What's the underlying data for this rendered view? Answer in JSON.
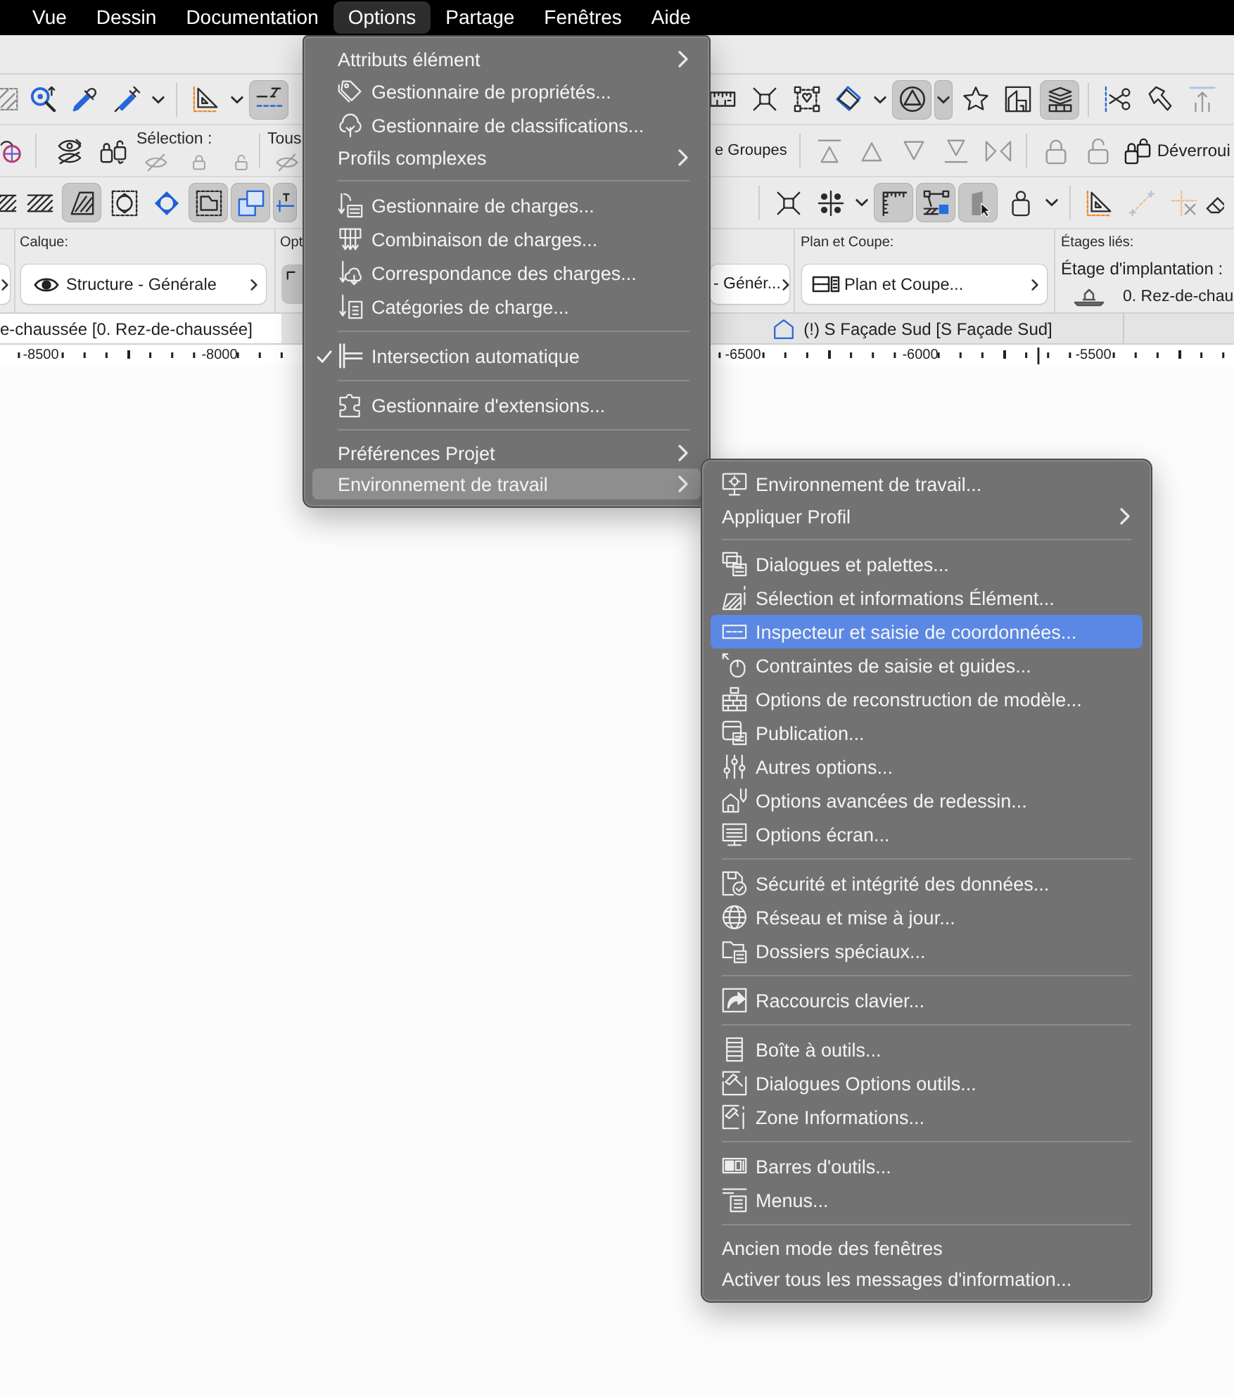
{
  "menu_bar": {
    "items": [
      {
        "label": "Vue",
        "selected": false
      },
      {
        "label": "Dessin",
        "selected": false
      },
      {
        "label": "Documentation",
        "selected": false
      },
      {
        "label": "Options",
        "selected": true
      },
      {
        "label": "Partage",
        "selected": false
      },
      {
        "label": "Fenêtres",
        "selected": false
      },
      {
        "label": "Aide",
        "selected": false
      }
    ]
  },
  "toolbar": {
    "rows": [
      {
        "left": [
          {
            "kind": "tool",
            "on": false,
            "disabled": false
          },
          {
            "kind": "tool",
            "on": false,
            "disabled": false
          },
          {
            "kind": "tool",
            "on": false,
            "disabled": false
          },
          {
            "kind": "tool",
            "on": false,
            "disabled": false
          },
          {
            "kind": "caret",
            "on": false,
            "disabled": false
          },
          {
            "kind": "divider"
          },
          {
            "kind": "tool",
            "on": false,
            "disabled": false
          },
          {
            "kind": "caret",
            "on": false,
            "disabled": false
          },
          {
            "kind": "tool",
            "on": true,
            "disabled": false
          }
        ],
        "right": [
          {
            "kind": "tool",
            "on": false,
            "disabled": false
          },
          {
            "kind": "tool",
            "on": false,
            "disabled": false
          },
          {
            "kind": "tool",
            "on": false,
            "disabled": false
          },
          {
            "kind": "tool",
            "on": false,
            "disabled": false
          },
          {
            "kind": "caret",
            "on": false,
            "disabled": false
          },
          {
            "kind": "tool",
            "on": true,
            "disabled": false
          },
          {
            "kind": "caret",
            "on": true,
            "disabled": false
          },
          {
            "kind": "tool",
            "on": false,
            "disabled": false
          },
          {
            "kind": "tool",
            "on": false,
            "disabled": false
          },
          {
            "kind": "tool",
            "on": true,
            "disabled": false
          },
          {
            "kind": "divider"
          },
          {
            "kind": "tool",
            "on": false,
            "disabled": false
          },
          {
            "kind": "tool",
            "on": false,
            "disabled": false
          },
          {
            "kind": "tool",
            "on": false,
            "disabled": true
          }
        ]
      },
      {
        "left": [
          {
            "kind": "tool",
            "on": false,
            "disabled": false
          },
          {
            "kind": "divider"
          },
          {
            "kind": "tool",
            "on": false,
            "disabled": false
          },
          {
            "kind": "tool",
            "on": false,
            "disabled": false
          },
          {
            "kind": "caption",
            "label": "Sélection :",
            "tools": [
              {
                "disabled": true
              },
              {
                "disabled": true
              },
              {
                "disabled": true
              }
            ]
          },
          {
            "kind": "divider"
          },
          {
            "kind": "caption",
            "label": "Tous",
            "tools": [
              {
                "disabled": true
              }
            ]
          }
        ],
        "right": [
          {
            "kind": "text_button",
            "label": "e Groupes"
          },
          {
            "kind": "divider"
          },
          {
            "kind": "tool",
            "on": false,
            "disabled": true
          },
          {
            "kind": "tool",
            "on": false,
            "disabled": true
          },
          {
            "kind": "tool",
            "on": false,
            "disabled": true
          },
          {
            "kind": "tool",
            "on": false,
            "disabled": true
          },
          {
            "kind": "tool",
            "on": false,
            "disabled": true
          },
          {
            "kind": "divider"
          },
          {
            "kind": "tool",
            "on": false,
            "disabled": true
          },
          {
            "kind": "tool",
            "on": false,
            "disabled": true
          },
          {
            "kind": "text_button",
            "label": "Déverroui"
          }
        ]
      },
      {
        "left": [
          {
            "kind": "tool",
            "on": false,
            "disabled": false
          },
          {
            "kind": "tool",
            "on": false,
            "disabled": false
          },
          {
            "kind": "tool",
            "on": true,
            "disabled": false
          },
          {
            "kind": "tool",
            "on": false,
            "disabled": false
          },
          {
            "kind": "tool",
            "on": false,
            "disabled": false
          },
          {
            "kind": "tool",
            "on": true,
            "disabled": false
          },
          {
            "kind": "tool",
            "on": true,
            "disabled": false
          },
          {
            "kind": "tool",
            "on": true,
            "disabled": false
          }
        ],
        "right": [
          {
            "kind": "divider"
          },
          {
            "kind": "tool",
            "on": false,
            "disabled": false
          },
          {
            "kind": "tool",
            "on": false,
            "disabled": false
          },
          {
            "kind": "caret",
            "on": false,
            "disabled": false
          },
          {
            "kind": "tool",
            "on": true,
            "disabled": false
          },
          {
            "kind": "tool",
            "on": true,
            "disabled": false
          },
          {
            "kind": "tool",
            "on": true,
            "disabled": false
          },
          {
            "kind": "tool",
            "on": false,
            "disabled": false
          },
          {
            "kind": "caret",
            "on": false,
            "disabled": false
          },
          {
            "kind": "divider"
          },
          {
            "kind": "tool",
            "on": false,
            "disabled": false
          },
          {
            "kind": "tool",
            "on": false,
            "disabled": true
          },
          {
            "kind": "tool",
            "on": false,
            "disabled": true
          },
          {
            "kind": "tool",
            "on": false,
            "disabled": false
          }
        ]
      }
    ]
  },
  "info_box": {
    "left": [
      {
        "kind": "stub"
      },
      {
        "kind": "dropdown",
        "caption": "Calque:",
        "value": "Structure - Générale"
      },
      {
        "kind": "button",
        "caption": "Opt"
      }
    ],
    "right": [
      {
        "kind": "dropdown",
        "value": "- Génér..."
      },
      {
        "kind": "dropdown",
        "caption": "Plan et Coupe:",
        "value": "Plan et Coupe..."
      },
      {
        "kind": "stories",
        "caption": "Étages liés:",
        "label": "Étage d'implantation :",
        "value": "0. Rez-de-chau"
      }
    ]
  },
  "tabs": [
    {
      "label": "e-chaussée [0. Rez-de-chaussée]",
      "selected": true
    },
    {
      "label": "(!) S Façade Sud [S Façade Sud]",
      "selected": false
    }
  ],
  "ruler": {
    "labels": [
      "-8500",
      "-8000",
      "-6500",
      "-6000",
      "-5500"
    ]
  },
  "options_menu": {
    "sections": [
      {
        "items": [
          {
            "label": "Attributs élément",
            "submenu": true,
            "checked": false,
            "selected": false
          },
          {
            "label": "Gestionnaire de propriétés...",
            "submenu": false,
            "checked": false,
            "selected": false
          },
          {
            "label": "Gestionnaire de classifications...",
            "submenu": false,
            "checked": false,
            "selected": false
          },
          {
            "label": "Profils complexes",
            "submenu": true,
            "checked": false,
            "selected": false
          }
        ]
      },
      {
        "items": [
          {
            "label": "Gestionnaire de charges...",
            "submenu": false,
            "checked": false,
            "selected": false
          },
          {
            "label": "Combinaison de charges...",
            "submenu": false,
            "checked": false,
            "selected": false
          },
          {
            "label": "Correspondance des charges...",
            "submenu": false,
            "checked": false,
            "selected": false
          },
          {
            "label": "Catégories de charge...",
            "submenu": false,
            "checked": false,
            "selected": false
          }
        ]
      },
      {
        "items": [
          {
            "label": "Intersection automatique",
            "submenu": false,
            "checked": true,
            "selected": false
          }
        ]
      },
      {
        "items": [
          {
            "label": "Gestionnaire d'extensions...",
            "submenu": false,
            "checked": false,
            "selected": false
          }
        ]
      },
      {
        "items": [
          {
            "label": "Préférences Projet",
            "submenu": true,
            "checked": false,
            "selected": false
          },
          {
            "label": "Environnement de travail",
            "submenu": true,
            "checked": false,
            "selected": true
          }
        ]
      }
    ]
  },
  "environment_submenu": {
    "sections": [
      {
        "items": [
          {
            "label": "Environnement de travail...",
            "submenu": false,
            "selected": false
          },
          {
            "label": "Appliquer Profil",
            "submenu": true,
            "selected": false
          }
        ]
      },
      {
        "items": [
          {
            "label": "Dialogues et palettes...",
            "submenu": false,
            "selected": false
          },
          {
            "label": "Sélection et informations Élément...",
            "submenu": false,
            "selected": false
          },
          {
            "label": "Inspecteur et saisie de coordonnées...",
            "submenu": false,
            "selected": true
          },
          {
            "label": "Contraintes de saisie et guides...",
            "submenu": false,
            "selected": false
          },
          {
            "label": "Options de reconstruction de modèle...",
            "submenu": false,
            "selected": false
          },
          {
            "label": "Publication...",
            "submenu": false,
            "selected": false
          },
          {
            "label": "Autres options...",
            "submenu": false,
            "selected": false
          },
          {
            "label": "Options avancées de redessin...",
            "submenu": false,
            "selected": false
          },
          {
            "label": "Options écran...",
            "submenu": false,
            "selected": false
          }
        ]
      },
      {
        "items": [
          {
            "label": "Sécurité et intégrité des données...",
            "submenu": false,
            "selected": false
          },
          {
            "label": "Réseau et mise à jour...",
            "submenu": false,
            "selected": false
          },
          {
            "label": "Dossiers spéciaux...",
            "submenu": false,
            "selected": false
          }
        ]
      },
      {
        "items": [
          {
            "label": "Raccourcis clavier...",
            "submenu": false,
            "selected": false
          }
        ]
      },
      {
        "items": [
          {
            "label": "Boîte à outils...",
            "submenu": false,
            "selected": false
          },
          {
            "label": "Dialogues Options outils...",
            "submenu": false,
            "selected": false
          },
          {
            "label": "Zone Informations...",
            "submenu": false,
            "selected": false
          }
        ]
      },
      {
        "items": [
          {
            "label": "Barres d'outils...",
            "submenu": false,
            "selected": false
          },
          {
            "label": "Menus...",
            "submenu": false,
            "selected": false
          }
        ]
      },
      {
        "items": [
          {
            "label": "Ancien mode des fenêtres",
            "submenu": false,
            "selected": false
          },
          {
            "label": "Activer tous les messages d'information...",
            "submenu": false,
            "selected": false
          }
        ]
      }
    ]
  }
}
